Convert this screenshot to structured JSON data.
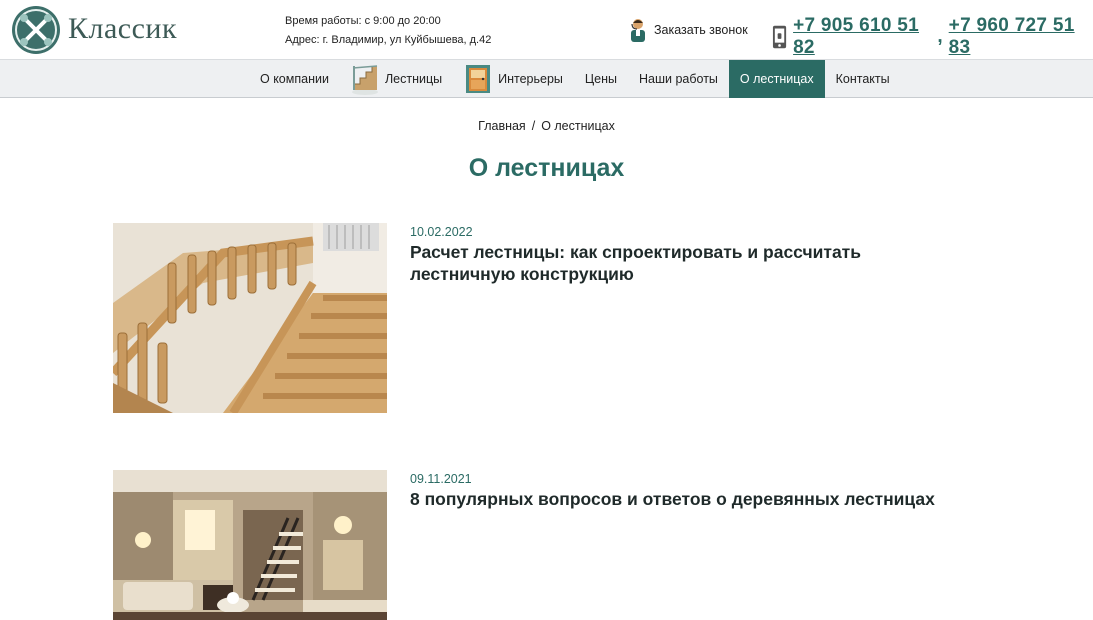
{
  "header": {
    "brand": "Классик",
    "hours": "Время работы: с 9:00 до 20:00",
    "address": "Адрес: г. Владимир, ул Куйбышева, д.42",
    "callback_label": "Заказать звонок",
    "phone1": "+7 905 610 51 82",
    "phone_sep": ",",
    "phone2": "+7 960 727 51 83"
  },
  "nav": {
    "items": [
      {
        "label": "О компании"
      },
      {
        "label": "Лестницы"
      },
      {
        "label": "Интерьеры"
      },
      {
        "label": "Цены"
      },
      {
        "label": "Наши работы"
      },
      {
        "label": "О лестницах"
      },
      {
        "label": "Контакты"
      }
    ],
    "active_index": 5
  },
  "breadcrumb": {
    "home": "Главная",
    "separator": "/",
    "current": "О лестницах"
  },
  "page": {
    "title": "О лестницах"
  },
  "articles": [
    {
      "date": "10.02.2022",
      "title": "Расчет лестницы: как спроектировать и рассчитать лестничную конструкцию"
    },
    {
      "date": "09.11.2021",
      "title": "8 популярных вопросов и ответов о деревянных лестницах"
    }
  ],
  "colors": {
    "accent": "#2b6b64",
    "nav_bg": "#eef0f2",
    "text": "#222222"
  }
}
